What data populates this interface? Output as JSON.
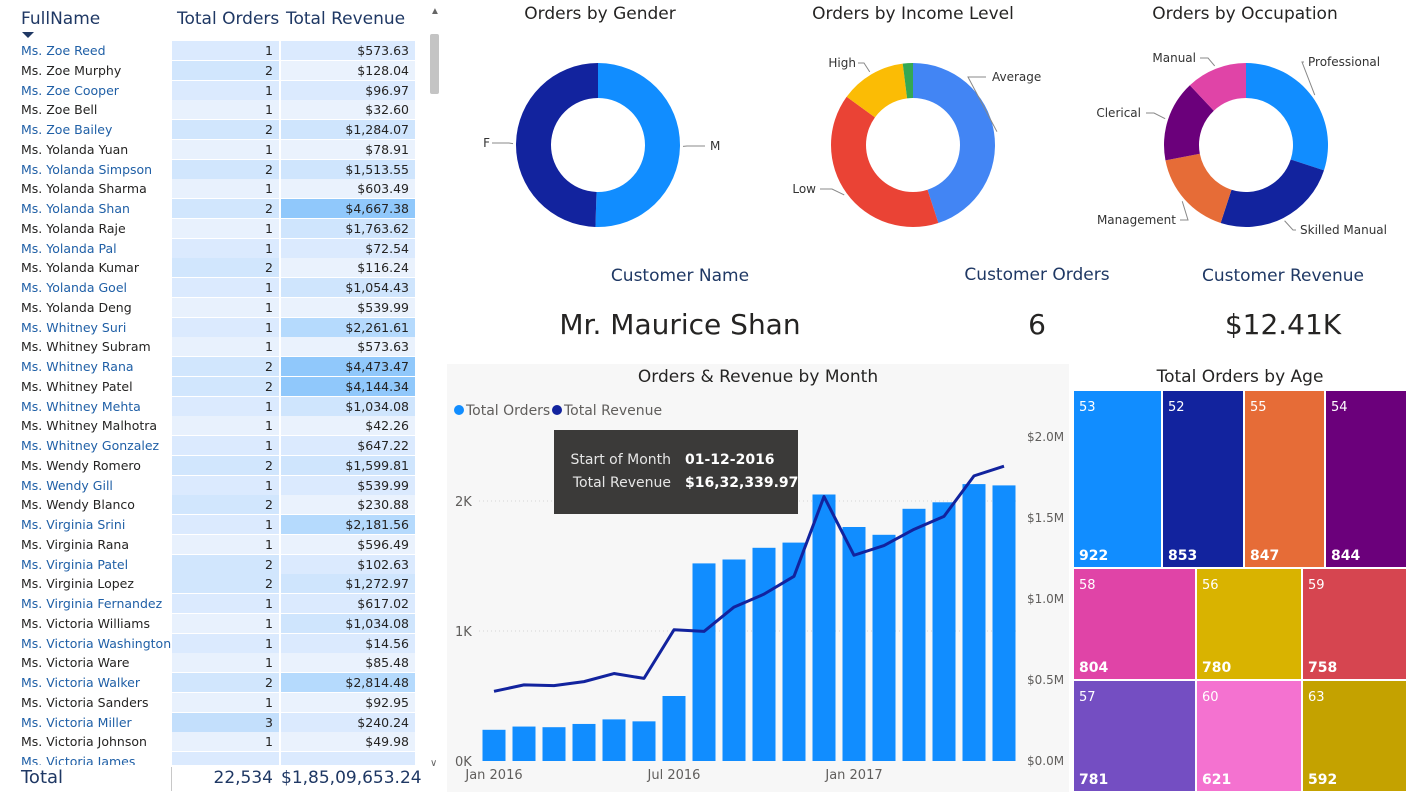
{
  "table": {
    "headers": {
      "name": "FullName",
      "orders": "Total Orders",
      "revenue": "Total Revenue"
    },
    "rows": [
      {
        "name": "Ms. Zoe Reed",
        "orders": "1",
        "revenue": "$573.63"
      },
      {
        "name": "Ms. Zoe Murphy",
        "orders": "2",
        "revenue": "$128.04"
      },
      {
        "name": "Ms. Zoe Cooper",
        "orders": "1",
        "revenue": "$96.97"
      },
      {
        "name": "Ms. Zoe Bell",
        "orders": "1",
        "revenue": "$32.60"
      },
      {
        "name": "Ms. Zoe Bailey",
        "orders": "2",
        "revenue": "$1,284.07"
      },
      {
        "name": "Ms. Yolanda Yuan",
        "orders": "1",
        "revenue": "$78.91"
      },
      {
        "name": "Ms. Yolanda Simpson",
        "orders": "2",
        "revenue": "$1,513.55"
      },
      {
        "name": "Ms. Yolanda Sharma",
        "orders": "1",
        "revenue": "$603.49"
      },
      {
        "name": "Ms. Yolanda Shan",
        "orders": "2",
        "revenue": "$4,667.38"
      },
      {
        "name": "Ms. Yolanda Raje",
        "orders": "1",
        "revenue": "$1,763.62"
      },
      {
        "name": "Ms. Yolanda Pal",
        "orders": "1",
        "revenue": "$72.54"
      },
      {
        "name": "Ms. Yolanda Kumar",
        "orders": "2",
        "revenue": "$116.24"
      },
      {
        "name": "Ms. Yolanda Goel",
        "orders": "1",
        "revenue": "$1,054.43"
      },
      {
        "name": "Ms. Yolanda Deng",
        "orders": "1",
        "revenue": "$539.99"
      },
      {
        "name": "Ms. Whitney Suri",
        "orders": "1",
        "revenue": "$2,261.61"
      },
      {
        "name": "Ms. Whitney Subram",
        "orders": "1",
        "revenue": "$573.63"
      },
      {
        "name": "Ms. Whitney Rana",
        "orders": "2",
        "revenue": "$4,473.47"
      },
      {
        "name": "Ms. Whitney Patel",
        "orders": "2",
        "revenue": "$4,144.34"
      },
      {
        "name": "Ms. Whitney Mehta",
        "orders": "1",
        "revenue": "$1,034.08"
      },
      {
        "name": "Ms. Whitney Malhotra",
        "orders": "1",
        "revenue": "$42.26"
      },
      {
        "name": "Ms. Whitney Gonzalez",
        "orders": "1",
        "revenue": "$647.22"
      },
      {
        "name": "Ms. Wendy Romero",
        "orders": "2",
        "revenue": "$1,599.81"
      },
      {
        "name": "Ms. Wendy Gill",
        "orders": "1",
        "revenue": "$539.99"
      },
      {
        "name": "Ms. Wendy Blanco",
        "orders": "2",
        "revenue": "$230.88"
      },
      {
        "name": "Ms. Virginia Srini",
        "orders": "1",
        "revenue": "$2,181.56"
      },
      {
        "name": "Ms. Virginia Rana",
        "orders": "1",
        "revenue": "$596.49"
      },
      {
        "name": "Ms. Virginia Patel",
        "orders": "2",
        "revenue": "$102.63"
      },
      {
        "name": "Ms. Virginia Lopez",
        "orders": "2",
        "revenue": "$1,272.97"
      },
      {
        "name": "Ms. Virginia Fernandez",
        "orders": "1",
        "revenue": "$617.02"
      },
      {
        "name": "Ms. Victoria Williams",
        "orders": "1",
        "revenue": "$1,034.08"
      },
      {
        "name": "Ms. Victoria Washington",
        "orders": "1",
        "revenue": "$14.56"
      },
      {
        "name": "Ms. Victoria Ware",
        "orders": "1",
        "revenue": "$85.48"
      },
      {
        "name": "Ms. Victoria Walker",
        "orders": "2",
        "revenue": "$2,814.48"
      },
      {
        "name": "Ms. Victoria Sanders",
        "orders": "1",
        "revenue": "$92.95"
      },
      {
        "name": "Ms. Victoria Miller",
        "orders": "3",
        "revenue": "$240.24"
      },
      {
        "name": "Ms. Victoria Johnson",
        "orders": "1",
        "revenue": "$49.98"
      },
      {
        "name": "Ms. Victoria James",
        "orders": "",
        "revenue": ""
      }
    ],
    "total": {
      "label": "Total",
      "orders": "22,534",
      "revenue": "$1,85,09,653.24"
    }
  },
  "donut_gender": {
    "title": "Orders by Gender",
    "slices": [
      {
        "label": "M",
        "share": 0.505,
        "color": "#118dff"
      },
      {
        "label": "F",
        "share": 0.495,
        "color": "#12239e"
      }
    ]
  },
  "donut_income": {
    "title": "Orders by Income Level",
    "slices": [
      {
        "label": "Average",
        "share": 0.45,
        "color": "#4285f4"
      },
      {
        "label": "Low",
        "share": 0.4,
        "color": "#ea4335"
      },
      {
        "label": "High",
        "share": 0.13,
        "color": "#fbbc05"
      },
      {
        "label": "",
        "share": 0.02,
        "color": "#34a853"
      }
    ]
  },
  "donut_occupation": {
    "title": "Orders by Occupation",
    "slices": [
      {
        "label": "Professional",
        "share": 0.3,
        "color": "#118dff"
      },
      {
        "label": "Skilled Manual",
        "share": 0.25,
        "color": "#12239e"
      },
      {
        "label": "Management",
        "share": 0.17,
        "color": "#e66c37"
      },
      {
        "label": "Clerical",
        "share": 0.16,
        "color": "#6b007b"
      },
      {
        "label": "Manual",
        "share": 0.12,
        "color": "#e044a7"
      }
    ]
  },
  "cards": {
    "customer_name": {
      "title": "Customer Name",
      "value": "Mr. Maurice Shan"
    },
    "customer_orders": {
      "title": "Customer Orders",
      "value": "6"
    },
    "customer_revenue": {
      "title": "Customer Revenue",
      "value": "$12.41K"
    }
  },
  "chart_data": [
    {
      "type": "bar",
      "title": "Orders & Revenue by Month",
      "legend": [
        "Total Orders",
        "Total Revenue"
      ],
      "legend_position": "top-left",
      "x_tick_labels": [
        "Jan 2016",
        "Jul 2016",
        "Jan 2017"
      ],
      "y_left_ticks": [
        "0K",
        "1K",
        "2K"
      ],
      "y_right_ticks": [
        "$0.0M",
        "$0.5M",
        "$1.0M",
        "$1.5M",
        "$2.0M"
      ],
      "y_left_range": [
        0,
        2500
      ],
      "y_right_range": [
        0,
        2000000
      ],
      "grid": true,
      "series": [
        {
          "name": "Total Orders",
          "type": "bar",
          "color": "#118dff",
          "values": [
            240,
            265,
            260,
            285,
            320,
            305,
            500,
            1520,
            1550,
            1640,
            1680,
            2050,
            1800,
            1740,
            1940,
            1990,
            2130,
            2120
          ]
        },
        {
          "name": "Total Revenue",
          "type": "line",
          "color": "#12239e",
          "values": [
            430000,
            470000,
            465000,
            490000,
            540000,
            510000,
            810000,
            800000,
            950000,
            1030000,
            1140000,
            1632340,
            1270000,
            1330000,
            1430000,
            1510000,
            1760000,
            1820000
          ]
        }
      ],
      "tooltip": {
        "k1": "Start of Month",
        "v1": "01-12-2016",
        "k2": "Total Revenue",
        "v2": "$16,32,339.97"
      }
    },
    {
      "type": "treemap",
      "title": "Total Orders by Age",
      "cells": [
        {
          "age": "53",
          "value": 922,
          "color": "#118dff"
        },
        {
          "age": "52",
          "value": 853,
          "color": "#12239e"
        },
        {
          "age": "55",
          "value": 847,
          "color": "#e66c37"
        },
        {
          "age": "54",
          "value": 844,
          "color": "#6b007b"
        },
        {
          "age": "58",
          "value": 804,
          "color": "#e044a7"
        },
        {
          "age": "56",
          "value": 780,
          "color": "#d9b300"
        },
        {
          "age": "59",
          "value": 758,
          "color": "#d64550"
        },
        {
          "age": "57",
          "value": 781,
          "color": "#744ec2"
        },
        {
          "age": "60",
          "value": 621,
          "color": "#f472d0"
        },
        {
          "age": "63",
          "value": 592,
          "color": "#c4a200"
        }
      ]
    }
  ]
}
